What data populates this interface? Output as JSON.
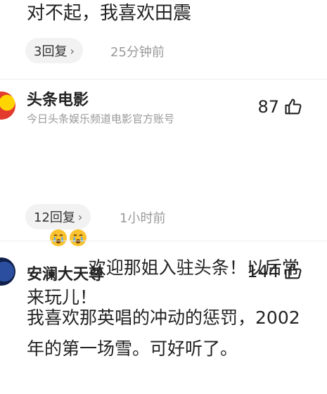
{
  "comment_top": {
    "text": "对不起，我喜欢田震",
    "replies_label": "3回复",
    "time": "25分钟前"
  },
  "comment_movie": {
    "author": "头条电影",
    "subtitle": "今日头条娱乐频道电影官方账号",
    "likes": "87",
    "text_after_emojis": "欢迎那姐入驻头条！以后常来玩儿！",
    "emojis": [
      "crying-emoji",
      "crying-emoji"
    ],
    "replies_label": "12回复",
    "time": "1小时前"
  },
  "comment_user": {
    "author": "安澜大天尊",
    "likes": "144",
    "text": "我喜欢那英唱的冲动的惩罚，2002年的第一场雪。可好听了。"
  },
  "colors": {
    "text": "#222222",
    "muted": "#999999",
    "pill_bg": "#f2f2f2"
  }
}
